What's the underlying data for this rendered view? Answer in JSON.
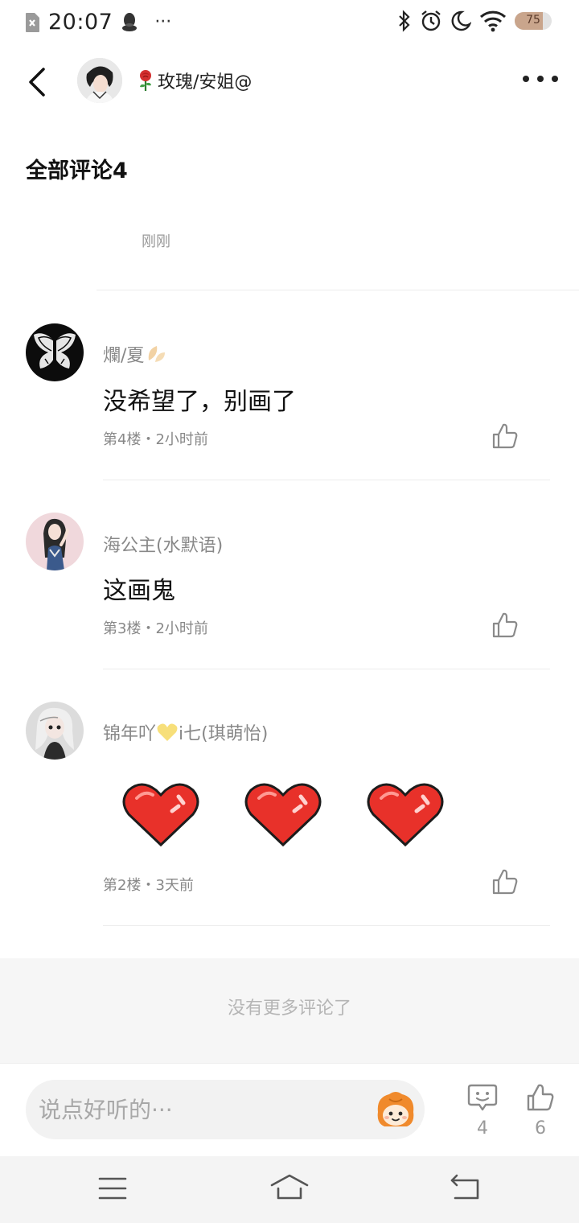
{
  "status_bar": {
    "time": "20:07",
    "more": "···",
    "battery": "75",
    "battery_level": 0.75
  },
  "header": {
    "title": "玫瑰/安姐@"
  },
  "comments_section": {
    "title": "全部评论4",
    "just_now": "刚刚"
  },
  "comments": [
    {
      "name": "爛/夏",
      "text": "没希望了，别画了",
      "meta": "第4楼・2小时前"
    },
    {
      "name": "海公主(水默语)",
      "text": "这画鬼",
      "meta": "第3楼・2小时前"
    },
    {
      "name_prefix": "锦年吖",
      "name_suffix": "i七(琪萌怡)",
      "text": "",
      "meta": "第2楼・3天前"
    }
  ],
  "no_more": "没有更多评论了",
  "input": {
    "placeholder": "说点好听的···"
  },
  "stats": {
    "comments": "4",
    "likes": "6"
  },
  "icons": [
    "back-icon",
    "more-icon",
    "rose-icon",
    "like-icon",
    "comment-icon",
    "menu-icon",
    "home-icon",
    "return-icon"
  ]
}
